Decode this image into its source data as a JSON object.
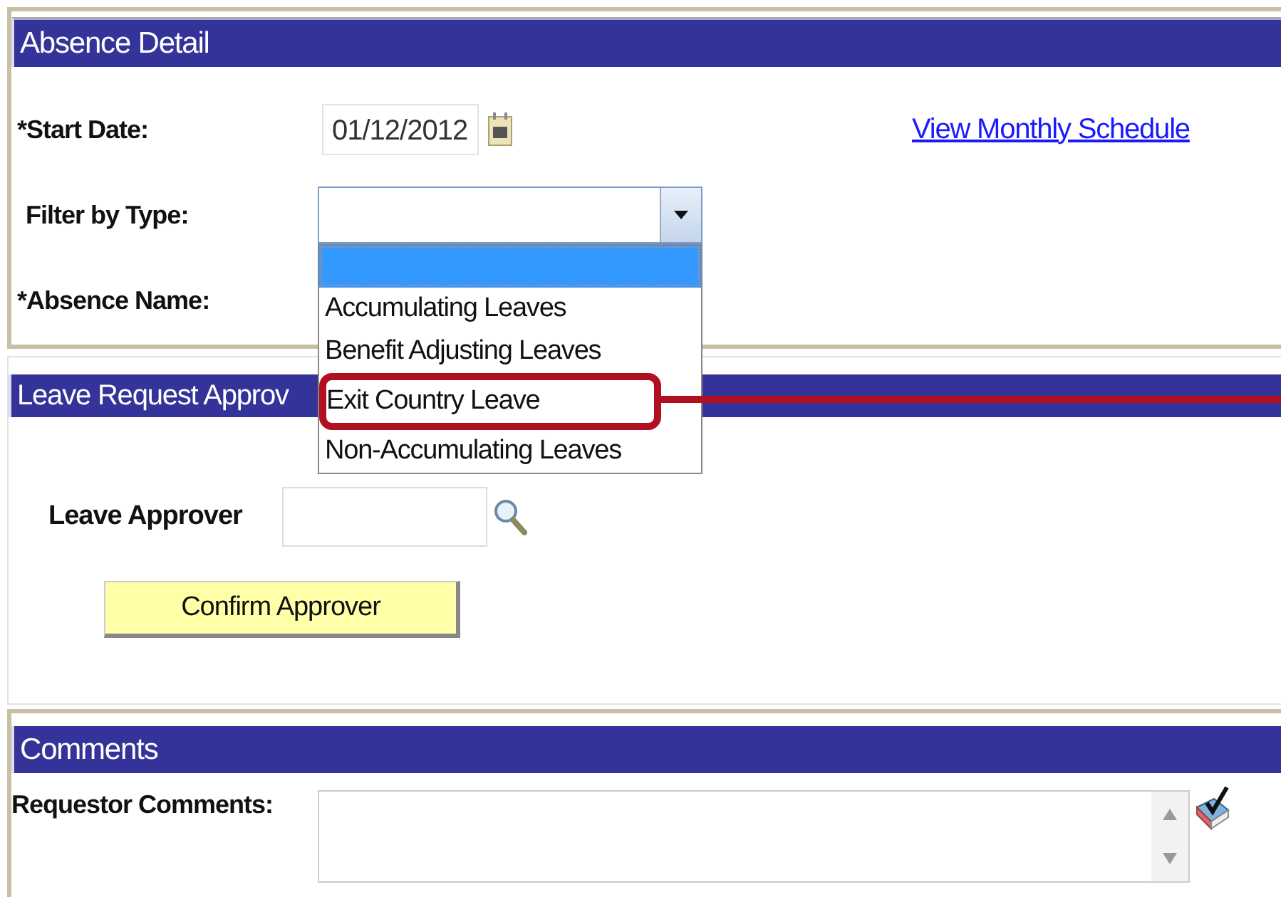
{
  "absence_detail": {
    "title": "Absence Detail",
    "start_date": {
      "label": "*Start Date:",
      "value": "01/12/2012"
    },
    "link": "View Monthly Schedule",
    "filter_by_type": {
      "label": "Filter by Type:",
      "expanded": true,
      "options": [
        {
          "selected": true,
          "highlighted": false
        },
        {
          "label": "Accumulating Leaves",
          "selected": false,
          "highlighted": false
        },
        {
          "label": "Benefit Adjusting Leaves",
          "selected": false,
          "highlighted": false
        },
        {
          "label": "Exit Country Leave",
          "selected": false,
          "highlighted": true
        },
        {
          "label": "Non-Accumulating Leaves",
          "selected": false,
          "highlighted": false
        }
      ]
    },
    "absence_name": {
      "label": "*Absence Name:"
    }
  },
  "leave_request_approval": {
    "title": "Leave Request Approv",
    "approver_label": "Leave Approver",
    "confirm_button": "Confirm Approver"
  },
  "comments": {
    "title": "Comments",
    "requestor_label": "Requestor Comments:"
  }
}
